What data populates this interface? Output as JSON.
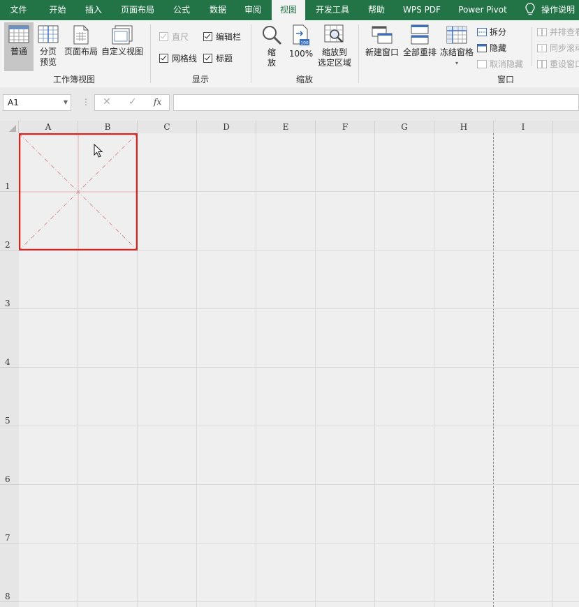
{
  "menu": {
    "tabs": [
      "文件",
      "开始",
      "插入",
      "页面布局",
      "公式",
      "数据",
      "审阅",
      "视图",
      "开发工具",
      "帮助",
      "WPS PDF",
      "Power Pivot",
      "操作说明"
    ],
    "active": "视图",
    "accent": "#227447"
  },
  "ribbon": {
    "workbook_views": {
      "label": "工作簿视图",
      "normal": "普通",
      "page_break_1": "分页",
      "page_break_2": "预览",
      "page_layout": "页面布局",
      "custom_views": "自定义视图"
    },
    "show": {
      "label": "显示",
      "ruler": "直尺",
      "formula_bar": "编辑栏",
      "gridlines": "网格线",
      "headings": "标题"
    },
    "zoom": {
      "label": "缩放",
      "zoom_1": "缩",
      "zoom_2": "放",
      "zoom_100": "100%",
      "zoom_sel_1": "缩放到",
      "zoom_sel_2": "选定区域",
      "badge": "100"
    },
    "window": {
      "label": "窗口",
      "new_window": "新建窗口",
      "arrange_all": "全部重排",
      "freeze_panes": "冻结窗格",
      "split": "拆分",
      "hide": "隐藏",
      "unhide": "取消隐藏",
      "side_by_side": "并排查看",
      "sync_scroll": "同步滚动",
      "reset_position": "重设窗口位置"
    }
  },
  "formula_bar": {
    "name_box": "A1",
    "cancel": "✕",
    "enter": "✓",
    "fx": "fx",
    "value": ""
  },
  "sheet": {
    "columns": [
      "A",
      "B",
      "C",
      "D",
      "E",
      "F",
      "G",
      "H",
      "I"
    ],
    "rows": [
      "1",
      "2",
      "3",
      "4",
      "5",
      "6",
      "7",
      "8"
    ],
    "selection_color": "#e0201c"
  }
}
